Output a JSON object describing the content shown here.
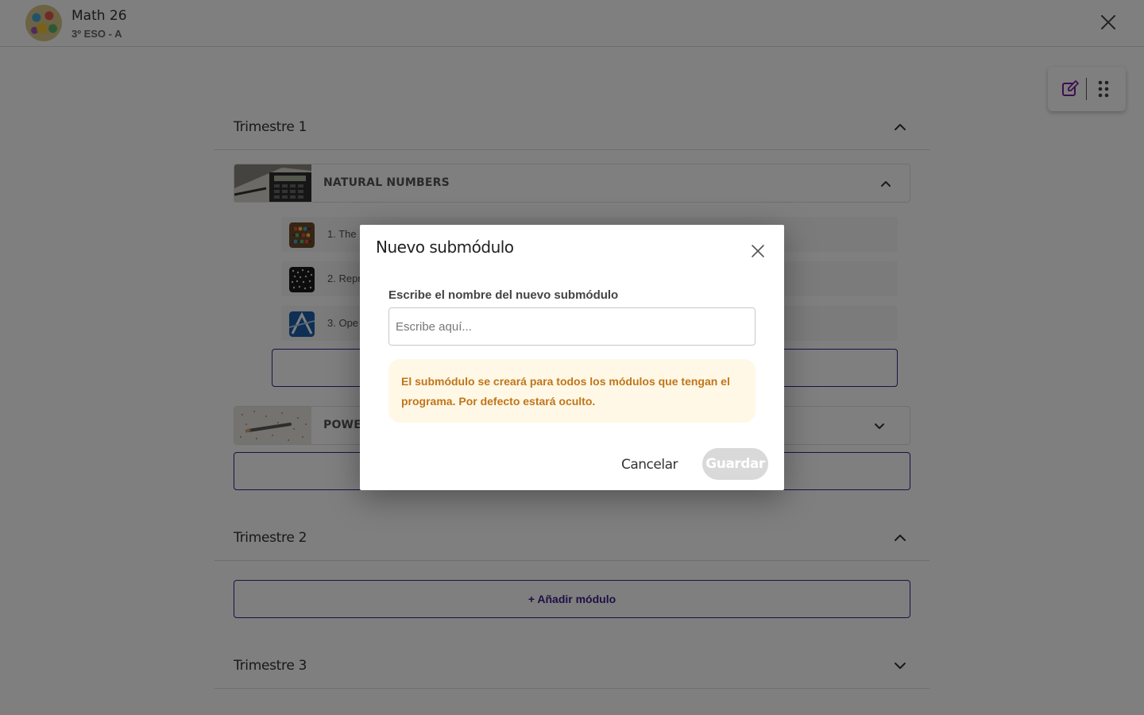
{
  "header": {
    "course_title": "Math 26",
    "course_subtitle": "3º ESO - A"
  },
  "terms": [
    {
      "title": "Trimestre 1",
      "expanded": true
    },
    {
      "title": "Trimestre 2",
      "expanded": true
    },
    {
      "title": "Trimestre 3",
      "expanded": false
    }
  ],
  "modules": [
    {
      "title": "NATURAL NUMBERS",
      "expanded": true,
      "submodules": [
        {
          "label": "1. The"
        },
        {
          "label": "2. Repr"
        },
        {
          "label": "3. Ope"
        }
      ]
    },
    {
      "title": "POWER",
      "expanded": false
    }
  ],
  "add_module_label": "+ Añadir módulo",
  "modal": {
    "title": "Nuevo submódulo",
    "field_label": "Escribe el nombre del nuevo submódulo",
    "field_placeholder": "Escribe aquí...",
    "field_value": "",
    "notice": "El submódulo se creará para todos los módulos que tengan el programa. Por defecto estará oculto.",
    "cancel_label": "Cancelar",
    "save_label": "Guardar"
  },
  "colors": {
    "accent": "#3b1e8a",
    "notice_text": "#c0751a",
    "notice_bg": "#fff8e6",
    "disabled_button": "#d9d9d9",
    "edit_icon": "#7a1fa2"
  },
  "icons": {
    "close": "close-icon",
    "edit": "edit-icon",
    "grid": "drag-grid-icon",
    "chevron_up": "chevron-up-icon",
    "chevron_down": "chevron-down-icon"
  }
}
